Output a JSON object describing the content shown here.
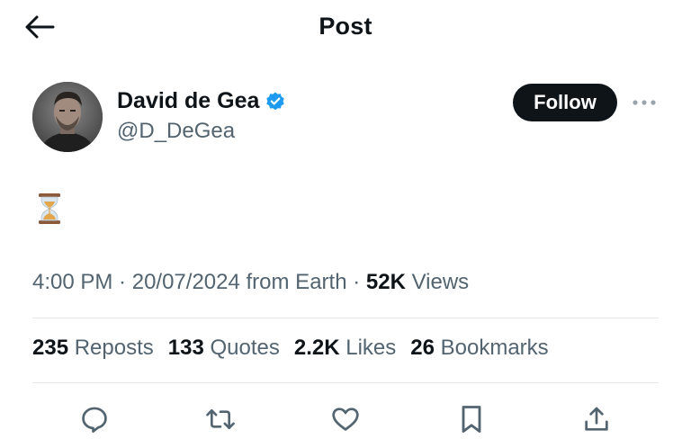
{
  "header": {
    "title": "Post",
    "back_icon": "arrow-left-icon"
  },
  "author": {
    "name": "David de Gea",
    "handle": "@D_DeGea",
    "verified_icon": "verified-badge-icon",
    "verified_color": "#1d9bf0"
  },
  "follow_label": "Follow",
  "more_icon": "more-horizontal-icon",
  "post": {
    "emoji": "⏳",
    "emoji_name": "hourglass-icon"
  },
  "meta": {
    "time": "4:00 PM",
    "sep1": " · ",
    "date": "20/07/2024",
    "source": " from Earth",
    "sep2": " · ",
    "views_count": "52K",
    "views_label": " Views"
  },
  "stats": {
    "reposts_count": "235",
    "reposts_label": " Reposts",
    "quotes_count": "133",
    "quotes_label": " Quotes",
    "likes_count": "2.2K",
    "likes_label": " Likes",
    "bookmarks_count": "26",
    "bookmarks_label": " Bookmarks"
  },
  "actions": [
    "reply-icon",
    "repost-icon",
    "like-icon",
    "bookmark-icon",
    "share-icon"
  ],
  "colors": {
    "text": "#0f1419",
    "secondary": "#536471",
    "divider": "#e6e9eb",
    "button_bg": "#0f1419"
  }
}
